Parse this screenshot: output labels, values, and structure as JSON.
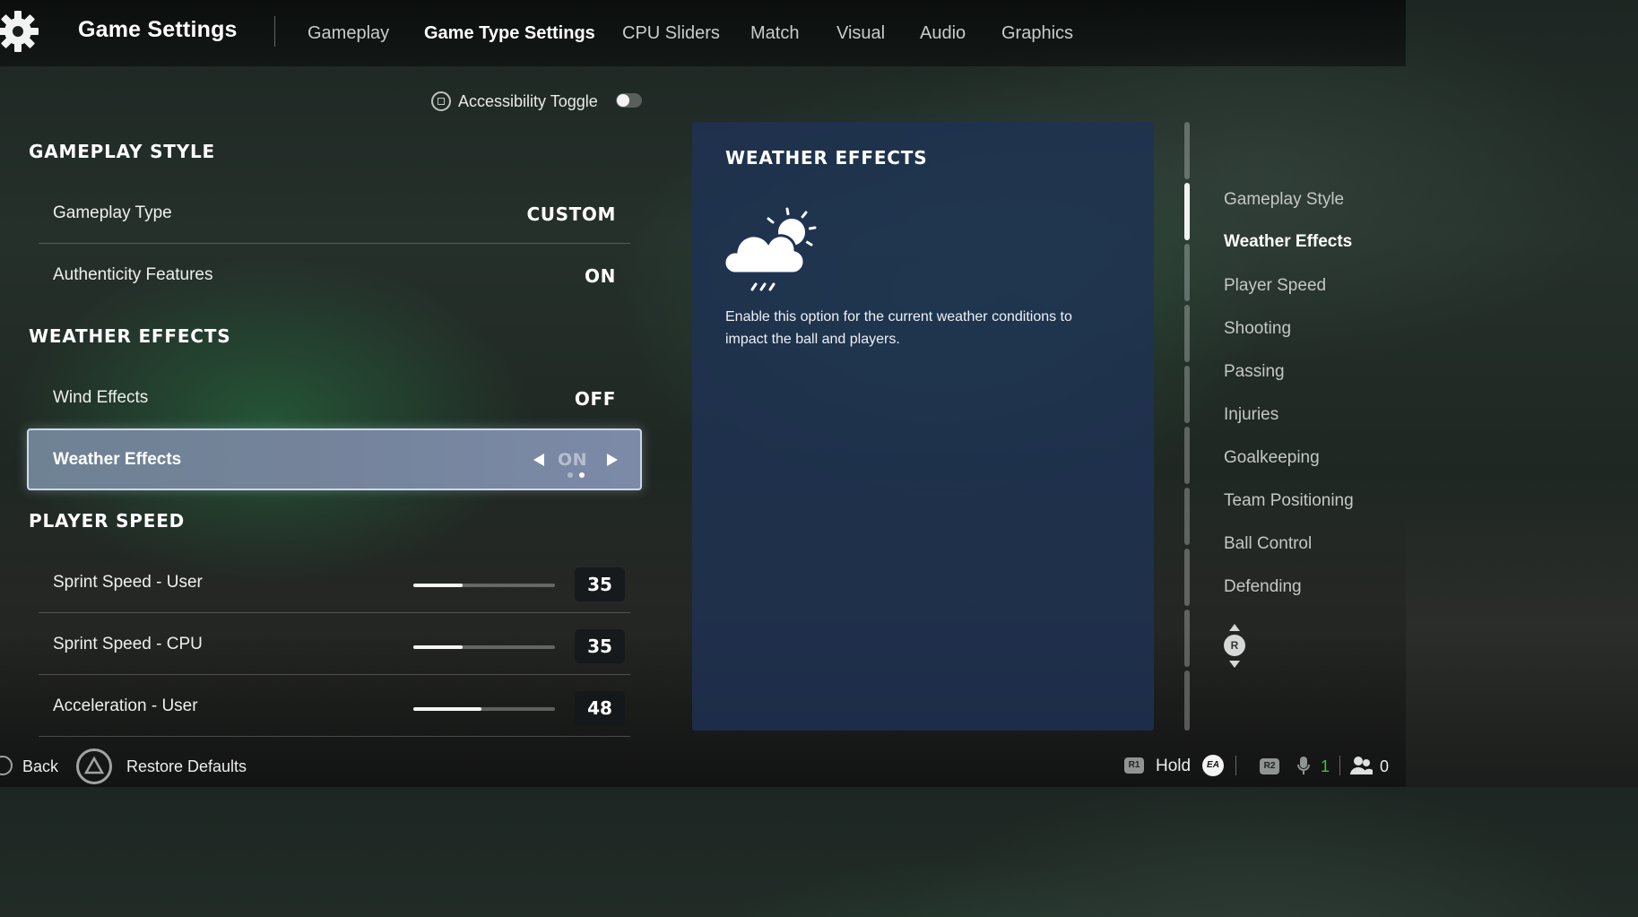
{
  "header": {
    "title": "Game Settings",
    "tabs": [
      {
        "label": "Gameplay",
        "active": false
      },
      {
        "label": "Game Type Settings",
        "active": true
      },
      {
        "label": "CPU Sliders",
        "active": false
      },
      {
        "label": "Match",
        "active": false
      },
      {
        "label": "Visual",
        "active": false
      },
      {
        "label": "Audio",
        "active": false
      },
      {
        "label": "Graphics",
        "active": false
      }
    ]
  },
  "accessibility": {
    "label": "Accessibility Toggle",
    "enabled": false
  },
  "settings": {
    "gameplay_style": {
      "heading": "GAMEPLAY STYLE",
      "rows": [
        {
          "label": "Gameplay Type",
          "value": "CUSTOM"
        },
        {
          "label": "Authenticity Features",
          "value": "ON"
        }
      ]
    },
    "weather_effects": {
      "heading": "WEATHER EFFECTS",
      "rows": [
        {
          "label": "Wind Effects",
          "value": "OFF"
        }
      ],
      "selected": {
        "label": "Weather Effects",
        "value": "ON",
        "option_count": 2,
        "selected_index": 1
      }
    },
    "player_speed": {
      "heading": "PLAYER SPEED",
      "rows": [
        {
          "label": "Sprint Speed - User",
          "value": "35",
          "fraction": 0.35
        },
        {
          "label": "Sprint Speed - CPU",
          "value": "35",
          "fraction": 0.35
        },
        {
          "label": "Acceleration - User",
          "value": "48",
          "fraction": 0.48
        }
      ]
    }
  },
  "info_panel": {
    "title": "WEATHER EFFECTS",
    "icon": "cloud-sun-rain-icon",
    "description": "Enable this option for the current weather conditions to impact the ball and players."
  },
  "side_nav": {
    "items": [
      {
        "label": "Gameplay Style",
        "active": false
      },
      {
        "label": "Weather Effects",
        "active": true
      },
      {
        "label": "Player Speed",
        "active": false
      },
      {
        "label": "Shooting",
        "active": false
      },
      {
        "label": "Passing",
        "active": false
      },
      {
        "label": "Injuries",
        "active": false
      },
      {
        "label": "Goalkeeping",
        "active": false
      },
      {
        "label": "Team Positioning",
        "active": false
      },
      {
        "label": "Ball Control",
        "active": false
      },
      {
        "label": "Defending",
        "active": false
      }
    ],
    "scroll_button": "R"
  },
  "footer": {
    "back_label": "Back",
    "restore_label": "Restore Defaults",
    "r1_badge": "R1",
    "hold_label": "Hold",
    "ea_badge": "EA",
    "r2_badge": "R2",
    "mic_count": "1",
    "players_count": "0",
    "mic_count_color": "#3ec43e"
  }
}
